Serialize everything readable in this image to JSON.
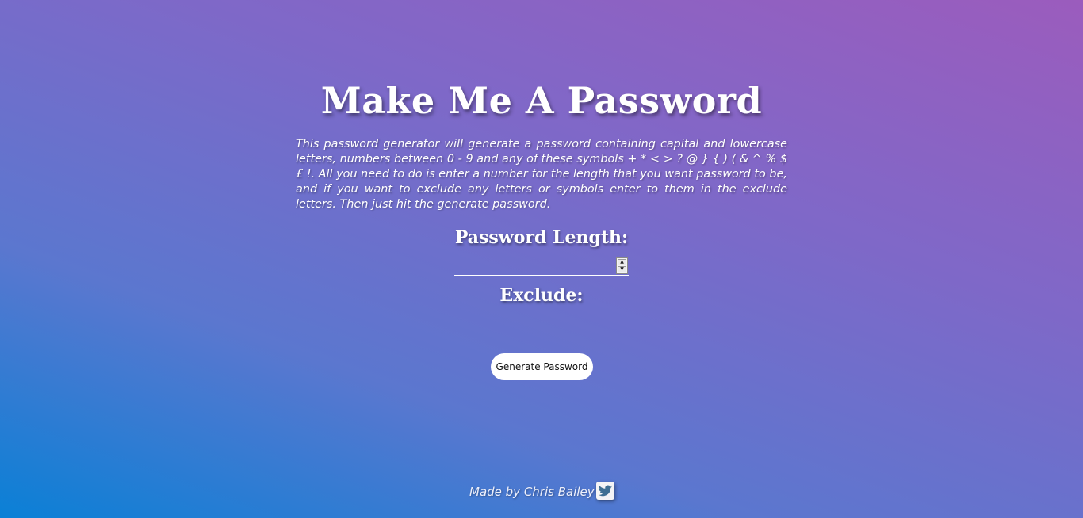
{
  "page": {
    "title": "Make Me A Password",
    "description": "This password generator will generate a password containing capital and lowercase letters, numbers between 0 - 9 and any of these symbols + * < > ? @ } { ) ( & ^ % $ £ !. All you need to do is enter a number for the length that you want password to be, and if you want to exclude any letters or symbols enter to them in the exclude letters. Then just hit the generate password."
  },
  "form": {
    "length_label": "Password Length:",
    "length_value": "",
    "exclude_label": "Exclude:",
    "exclude_value": "",
    "generate_label": "Generate Password"
  },
  "footer": {
    "credit": "Made by Chris Bailey",
    "social_icon": "twitter-icon"
  },
  "colors": {
    "gradient_top_right": "#9b5cbd",
    "gradient_bottom_left": "#0a80d6",
    "button_bg": "#ffffff"
  }
}
